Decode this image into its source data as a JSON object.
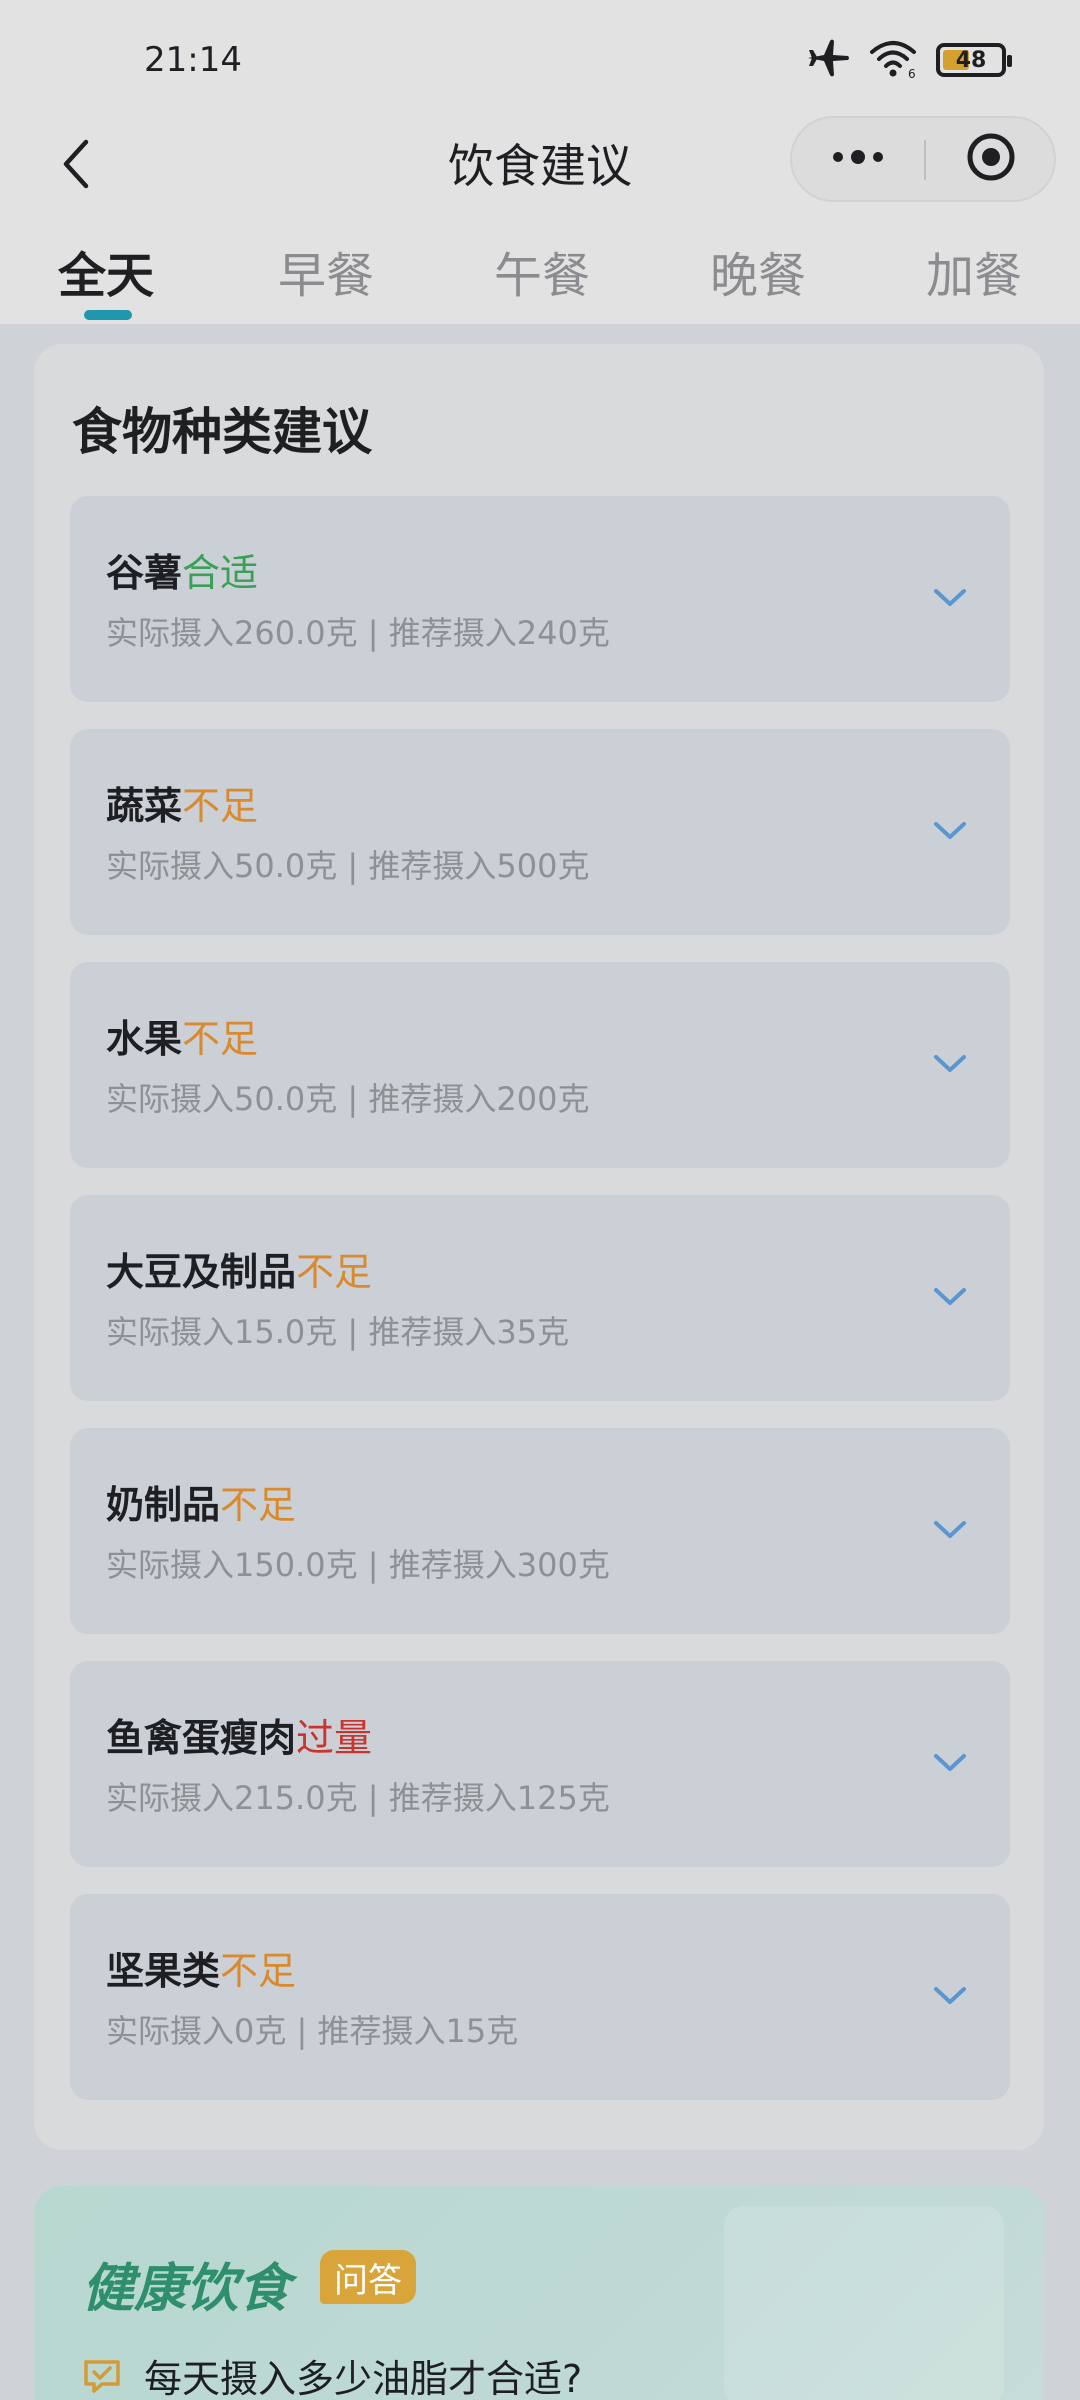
{
  "status_bar": {
    "time": "21:14",
    "icons": [
      "airplane-icon",
      "wifi-icon"
    ],
    "battery": "48",
    "battery_level": 0.48
  },
  "nav": {
    "title": "饮食建议",
    "back_icon": "chevron-left-icon",
    "more_icon": "more-dots-icon",
    "close_icon": "target-circle-icon"
  },
  "tabs": [
    {
      "label": "全天",
      "active": true
    },
    {
      "label": "早餐",
      "active": false
    },
    {
      "label": "午餐",
      "active": false
    },
    {
      "label": "晚餐",
      "active": false
    },
    {
      "label": "加餐",
      "active": false
    }
  ],
  "card": {
    "title": "食物种类建议",
    "items": [
      {
        "name": "谷薯",
        "status": "合适",
        "status_color": "#3aa055",
        "detail": "实际摄入260.0克 | 推荐摄入240克"
      },
      {
        "name": "蔬菜",
        "status": "不足",
        "status_color": "#d98a2e",
        "detail": "实际摄入50.0克 | 推荐摄入500克"
      },
      {
        "name": "水果",
        "status": "不足",
        "status_color": "#d98a2e",
        "detail": "实际摄入50.0克 | 推荐摄入200克"
      },
      {
        "name": "大豆及制品",
        "status": "不足",
        "status_color": "#d98a2e",
        "detail": "实际摄入15.0克 | 推荐摄入35克"
      },
      {
        "name": "奶制品",
        "status": "不足",
        "status_color": "#d98a2e",
        "detail": "实际摄入150.0克 | 推荐摄入300克"
      },
      {
        "name": "鱼禽蛋瘦肉",
        "status": "过量",
        "status_color": "#c9352e",
        "detail": "实际摄入215.0克 | 推荐摄入125克"
      },
      {
        "name": "坚果类",
        "status": "不足",
        "status_color": "#d98a2e",
        "detail": "实际摄入0克 | 推荐摄入15克"
      }
    ]
  },
  "qa": {
    "title": "健康饮食",
    "badge": "问答",
    "question": "每天摄入多少油脂才合适?"
  },
  "colors": {
    "accent": "#1f97ad",
    "chevron": "#5a96cf"
  }
}
